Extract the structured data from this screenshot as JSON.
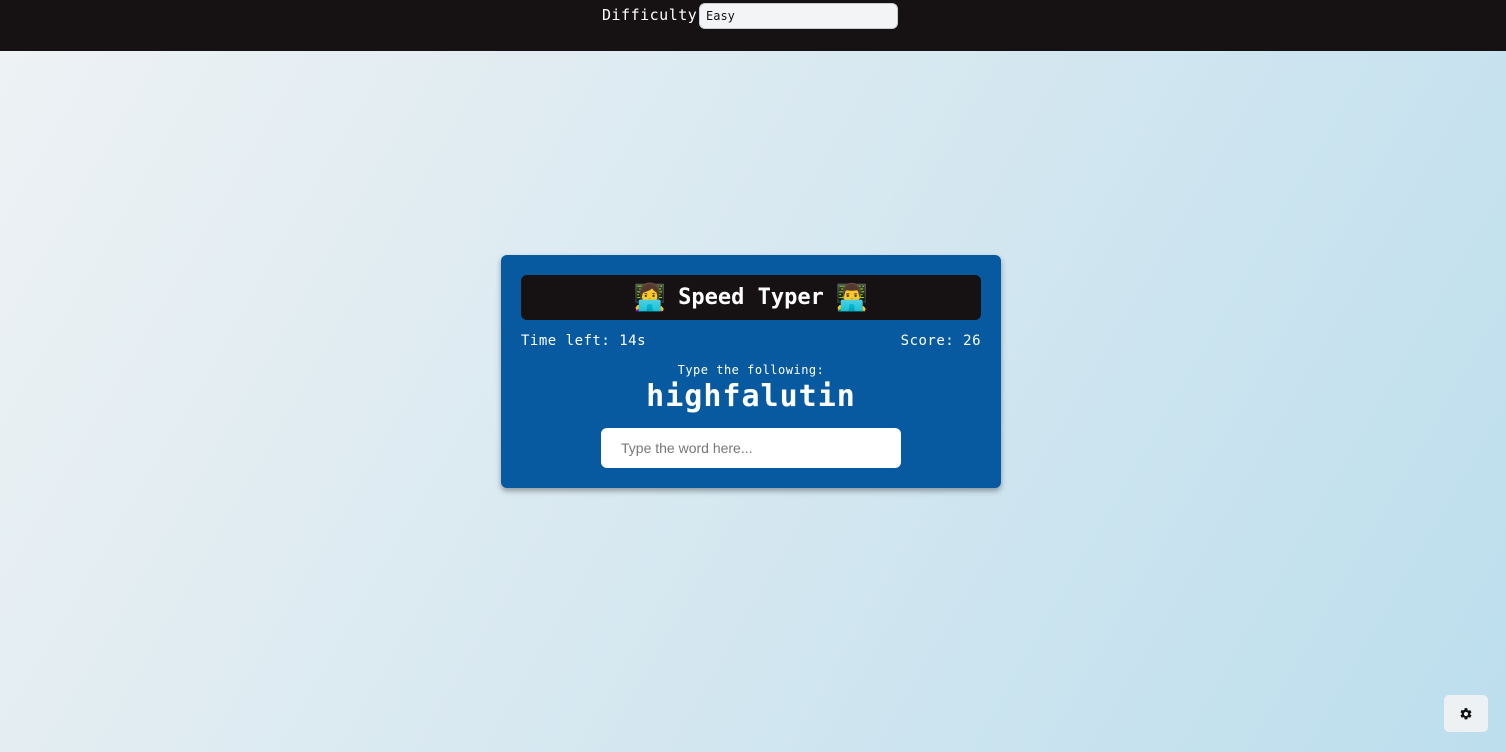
{
  "header": {
    "difficulty_label": "Difficulty",
    "difficulty_value": "Easy"
  },
  "game": {
    "title": "Speed Typer",
    "left_emoji": "👩‍💻",
    "right_emoji": "👨‍💻",
    "time_left": "Time left: 14s",
    "score": "Score: 26",
    "prompt_label": "Type the following:",
    "word": "highfalutin",
    "input_placeholder": "Type the word here...",
    "input_value": ""
  },
  "settings": {
    "icon": "gear-icon"
  },
  "colors": {
    "topbar": "#161213",
    "card": "#075aa0",
    "title_bar": "#161213",
    "text": "#ffffff"
  }
}
